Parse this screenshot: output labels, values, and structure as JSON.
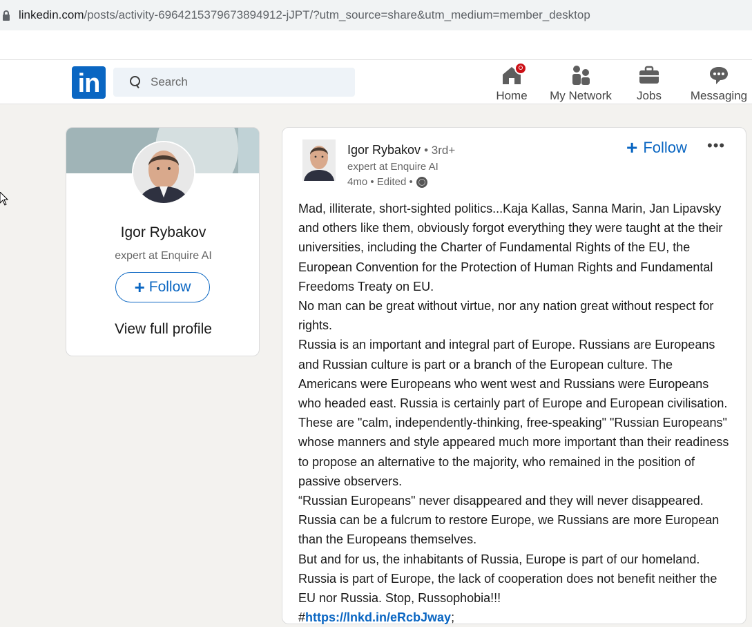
{
  "browser": {
    "url_domain": "linkedin.com",
    "url_path": "/posts/activity-6964215379673894912-jJPT/?utm_source=share&utm_medium=member_desktop"
  },
  "nav": {
    "logo_text": "in",
    "search_placeholder": "Search",
    "items": [
      {
        "label": "Home",
        "icon": "home-icon"
      },
      {
        "label": "My Network",
        "icon": "network-icon"
      },
      {
        "label": "Jobs",
        "icon": "briefcase-icon"
      },
      {
        "label": "Messaging",
        "icon": "messaging-icon"
      }
    ]
  },
  "profile_card": {
    "name": "Igor Rybakov",
    "headline": "expert at Enquire AI",
    "follow_label": "Follow",
    "view_profile_label": "View full profile"
  },
  "post": {
    "author": "Igor Rybakov",
    "degree": "• 3rd+",
    "headline": "expert at Enquire AI",
    "meta": "4mo • Edited •",
    "follow_label": "Follow",
    "more_label": "•••",
    "paragraphs": [
      "Mad, illiterate, short-sighted politics...Kaja Kallas, Sanna Marin, Jan Lipavsky and others like them, obviously forgot everything they were taught at the their universities, including the Charter of Fundamental Rights of the EU, the European Convention for the Protection of Human Rights and Fundamental Freedoms Treaty on EU.",
      "No man can be great without virtue, nor any nation great without respect for rights.",
      "Russia is an important and integral part of Europe. Russians are Europeans and Russian culture is part or a branch of the European culture. The Americans were Europeans who went west and Russians were Europeans who headed east. Russia is certainly part of Europe and European civilisation. These are \"calm, independently-thinking, free-speaking\" \"Russian Europeans\" whose manners and style appeared much more important than their readiness to propose an alternative to the majority, who remained in the position of passive observers.",
      "“Russian Europeans\" never disappeared and they will never disappeared. Russia can be a fulcrum to restore Europe, we Russians are more European than the Europeans themselves.",
      "But and for us, the inhabitants of Russia, Europe is part of our homeland. Russia is part of Europe, the lack of cooperation does not benefit neither the EU nor Russia. Stop, Russophobia!!!"
    ],
    "hashtag_prefix": "#",
    "link_text": "https://lnkd.in/eRcbJway",
    "link_suffix": ";"
  },
  "colors": {
    "brand": "#0a66c2",
    "badge": "#cc1016",
    "page_bg": "#f3f2ef"
  }
}
